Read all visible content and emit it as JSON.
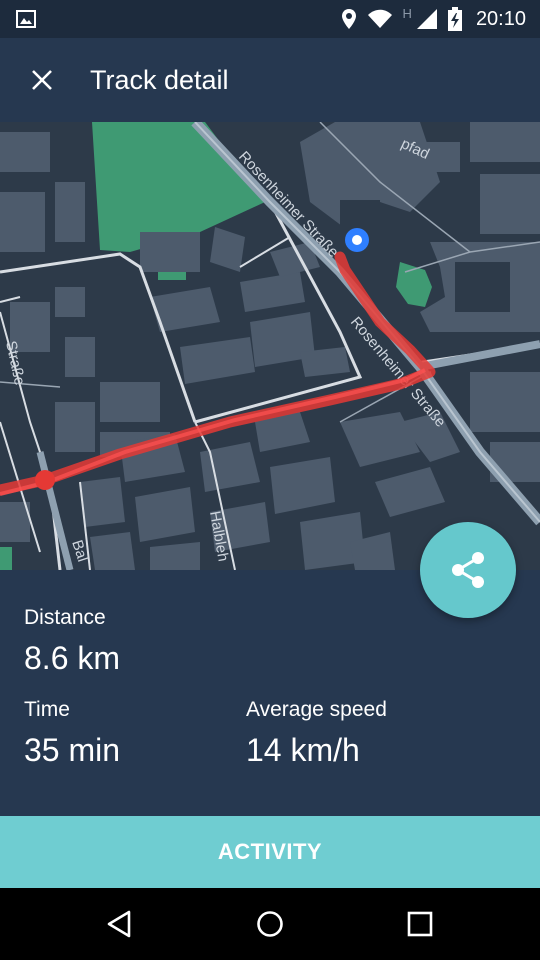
{
  "status_bar": {
    "time": "20:10",
    "network_mark": "H",
    "icons": [
      "image-icon",
      "location-icon",
      "wifi-icon",
      "signal-icon",
      "battery-charging-icon"
    ]
  },
  "toolbar": {
    "title": "Track detail",
    "close_icon": "close-icon"
  },
  "map": {
    "street_labels": [
      "Rosenheimer Straße",
      "Rosenheimer Straße",
      "Straße",
      "Halbleh",
      "Bal",
      "pfad"
    ]
  },
  "stats": {
    "distance_label": "Distance",
    "distance_value": "8.6 km",
    "time_label": "Time",
    "time_value": "35 min",
    "speed_label": "Average speed",
    "speed_value": "14 km/h"
  },
  "actions": {
    "activity_label": "ACTIVITY",
    "share_icon": "share-icon"
  },
  "nav": {
    "icons": [
      "back-icon",
      "home-icon",
      "recents-icon"
    ]
  },
  "colors": {
    "background": "#263850",
    "accent": "#6fcdd1",
    "route": "#e53935",
    "location_marker": "#2f7fff"
  }
}
